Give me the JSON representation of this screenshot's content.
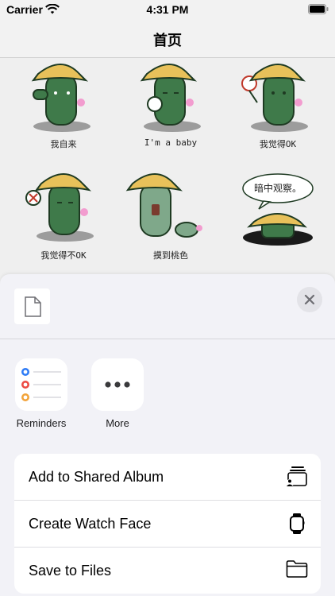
{
  "status_bar": {
    "carrier": "Carrier",
    "time": "4:31 PM"
  },
  "nav": {
    "title": "首页"
  },
  "stickers": [
    {
      "caption": "我自来"
    },
    {
      "caption": "I'm a baby"
    },
    {
      "caption": "我觉得OK"
    },
    {
      "caption": "我觉得不OK"
    },
    {
      "caption": "摸到桃色"
    },
    {
      "caption": "暗中观察。"
    }
  ],
  "share_sheet": {
    "apps": [
      {
        "label": "Reminders",
        "icon": "reminders-icon"
      },
      {
        "label": "More",
        "icon": "more-icon"
      }
    ],
    "actions": [
      {
        "label": "Add to Shared Album",
        "icon": "shared-album-icon"
      },
      {
        "label": "Create Watch Face",
        "icon": "watch-icon"
      },
      {
        "label": "Save to Files",
        "icon": "folder-icon"
      }
    ]
  },
  "colors": {
    "cactus": "#3f7a4a",
    "hat": "#e8c15a",
    "reminder_blue": "#2f7cf6",
    "reminder_red": "#ec4a43",
    "reminder_orange": "#f2a33a"
  }
}
